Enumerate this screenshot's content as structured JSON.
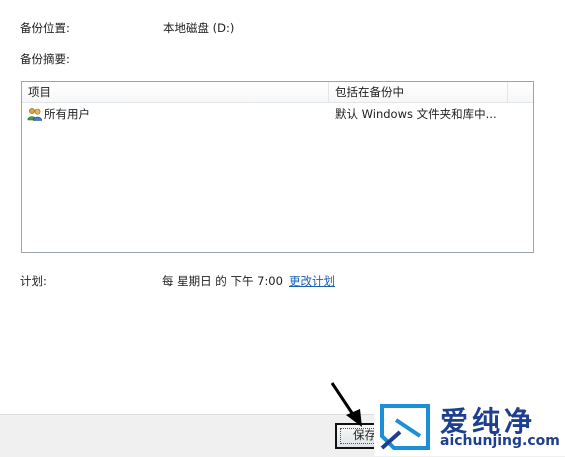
{
  "backup_location": {
    "label": "备份位置:",
    "value": "本地磁盘 (D:)"
  },
  "backup_summary": {
    "label": "备份摘要:",
    "columns": [
      "项目",
      "包括在备份中"
    ],
    "rows": [
      {
        "item": "所有用户",
        "included": "默认 Windows 文件夹和库中...",
        "icon": "users-icon"
      }
    ]
  },
  "schedule": {
    "label": "计划:",
    "value": "每 星期日 的 下午 7:00",
    "change_link": "更改计划"
  },
  "footer": {
    "save_button": "保存"
  },
  "watermark": {
    "brand": "爱纯净",
    "url": "aichunjing.com"
  },
  "colors": {
    "link": "#1a5fb4",
    "watermark": "#1c3f8f",
    "footer_bg": "#f0f0f0"
  }
}
